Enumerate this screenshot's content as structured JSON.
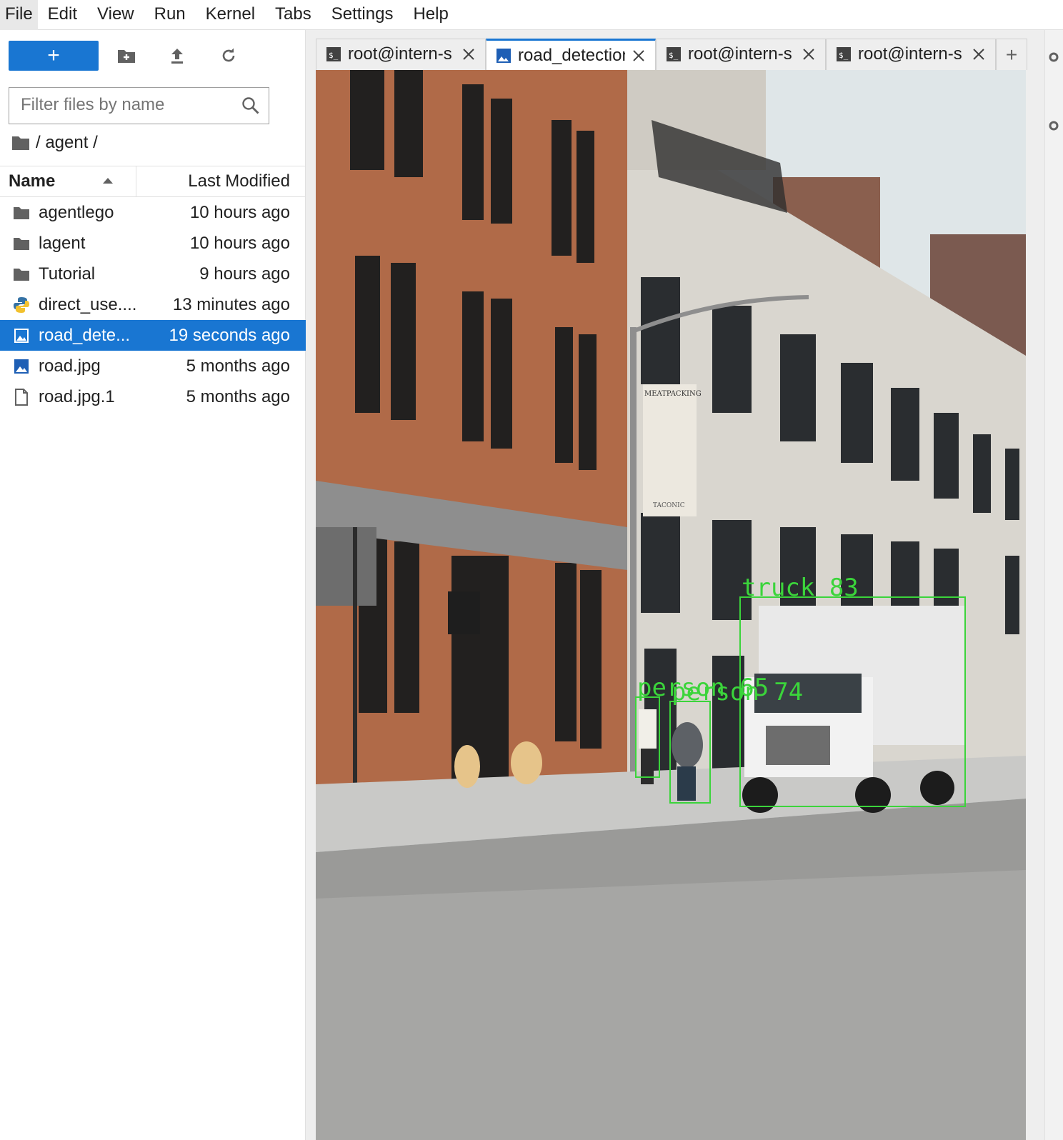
{
  "menu": [
    "File",
    "Edit",
    "View",
    "Run",
    "Kernel",
    "Tabs",
    "Settings",
    "Help"
  ],
  "sidebar": {
    "new_button_label": "+",
    "toolbar_icons": [
      "new-folder-icon",
      "upload-icon",
      "refresh-icon"
    ],
    "filter_placeholder": "Filter files by name",
    "breadcrumb": "/ agent /",
    "columns": {
      "name": "Name",
      "modified": "Last Modified"
    },
    "files": [
      {
        "icon": "folder-icon",
        "name": "agentlego",
        "modified": "10 hours ago"
      },
      {
        "icon": "folder-icon",
        "name": "lagent",
        "modified": "10 hours ago"
      },
      {
        "icon": "folder-icon",
        "name": "Tutorial",
        "modified": "9 hours ago"
      },
      {
        "icon": "python-icon",
        "name": "direct_use....",
        "modified": "13 minutes ago"
      },
      {
        "icon": "image-icon",
        "name": "road_dete...",
        "modified": "19 seconds ago",
        "selected": true
      },
      {
        "icon": "image-icon",
        "name": "road.jpg",
        "modified": "5 months ago"
      },
      {
        "icon": "file-icon",
        "name": "road.jpg.1",
        "modified": "5 months ago"
      }
    ]
  },
  "tabs": [
    {
      "icon": "terminal-icon",
      "label": "root@intern-s"
    },
    {
      "icon": "image-icon",
      "label": "road_detection",
      "active": true
    },
    {
      "icon": "terminal-icon",
      "label": "root@intern-s"
    },
    {
      "icon": "terminal-icon",
      "label": "root@intern-s"
    }
  ],
  "tab_add_label": "+",
  "image": {
    "detections": [
      {
        "label": "truck 83"
      },
      {
        "label": "person 65"
      },
      {
        "label": "person 74"
      }
    ],
    "signage": {
      "meatpacking": "MEATPACKING",
      "taconic": "TACONIC"
    },
    "colors": {
      "brick": "#b06a48",
      "stone": "#d9d6cf",
      "sky": "#dfe6e8",
      "road": "#9a9a98",
      "box": "#3bd43b"
    }
  }
}
